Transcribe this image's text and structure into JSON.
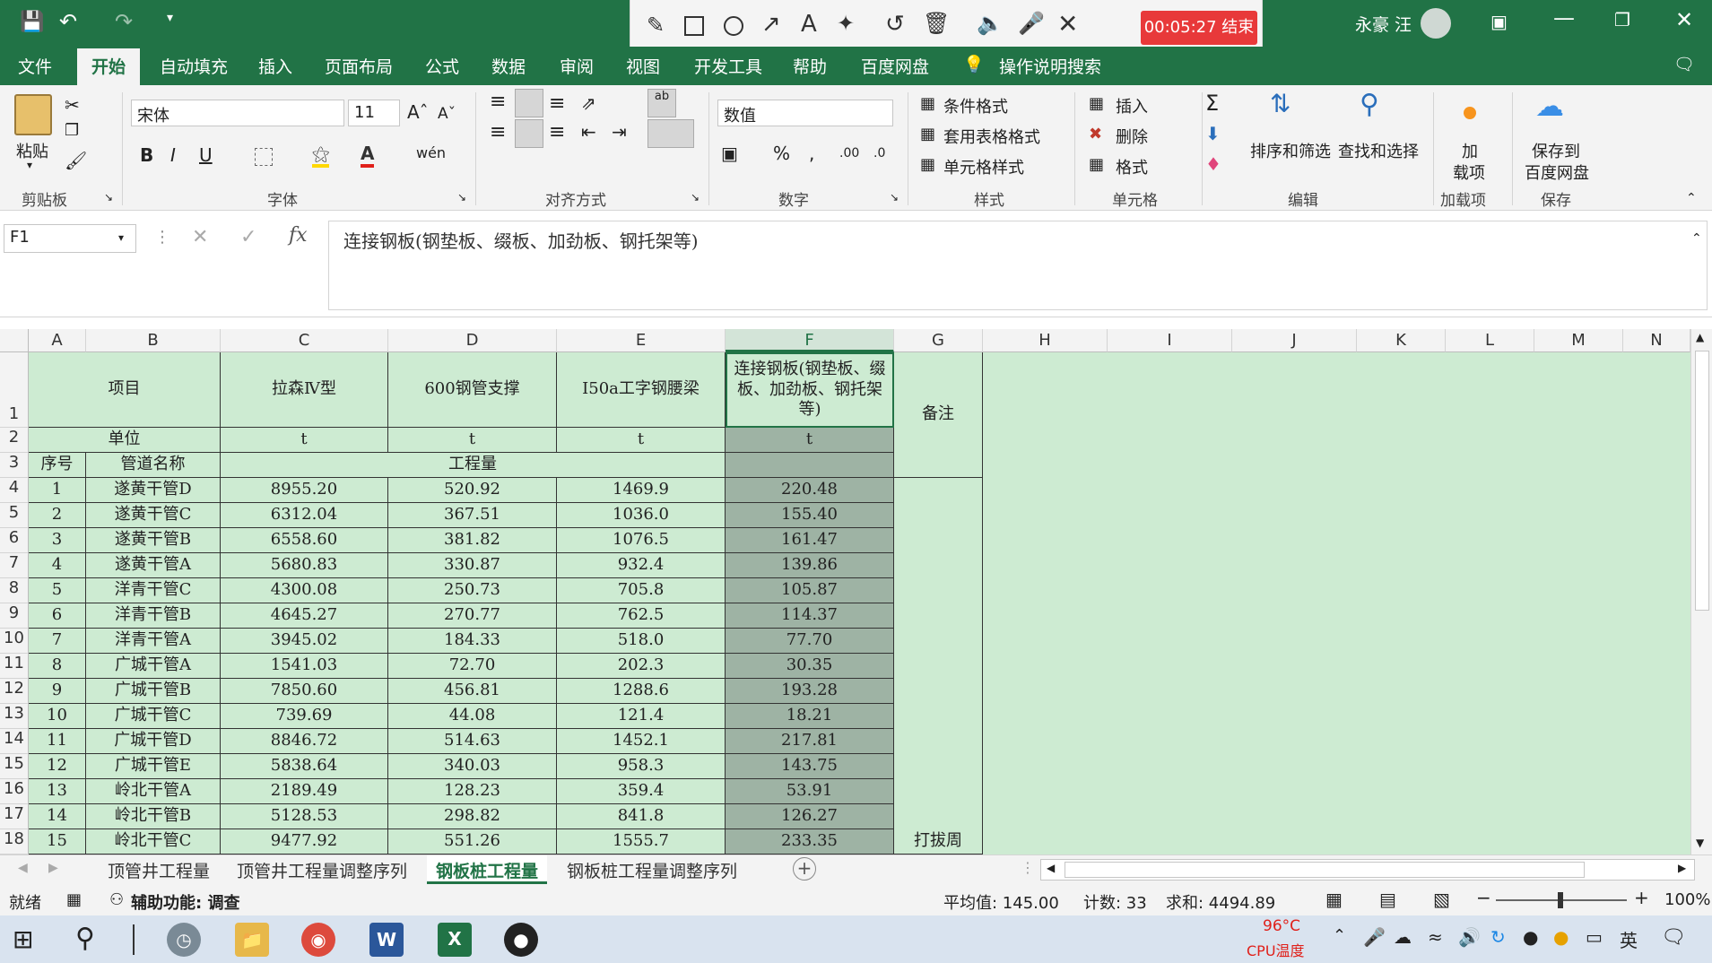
{
  "titlebar": {
    "user": "永豪 汪",
    "timer": "00:05:27 结束"
  },
  "menu": [
    "文件",
    "开始",
    "自动填充",
    "插入",
    "页面布局",
    "公式",
    "数据",
    "审阅",
    "视图",
    "开发工具",
    "帮助",
    "百度网盘",
    "操作说明搜索"
  ],
  "ribbon": {
    "paste": "粘贴",
    "font_name": "宋体",
    "font_size": "11",
    "number_format": "数值",
    "cond_format": "条件格式",
    "table_format": "套用表格格式",
    "cell_style": "单元格样式",
    "insert": "插入",
    "delete": "删除",
    "format": "格式",
    "sort_filter": "排序和筛选",
    "find_select": "查找和选择",
    "addin_1": "加",
    "addin_2": "载项",
    "save_to_1": "保存到",
    "save_to_2": "百度网盘",
    "groups": {
      "clipboard": "剪贴板",
      "font": "字体",
      "align": "对齐方式",
      "number": "数字",
      "style": "样式",
      "cells": "单元格",
      "edit": "编辑",
      "addin": "加载项",
      "save": "保存"
    }
  },
  "formula": {
    "namebox": "F1",
    "content": "连接钢板(钢垫板、缀板、加劲板、钢托架等)"
  },
  "columns": [
    "A",
    "B",
    "C",
    "D",
    "E",
    "F",
    "G",
    "H",
    "I",
    "J",
    "K",
    "L",
    "M",
    "N"
  ],
  "rows_header": [
    "1",
    "2",
    "3",
    "4",
    "5",
    "6",
    "7",
    "8",
    "9",
    "10",
    "11",
    "12",
    "13",
    "14",
    "15",
    "16",
    "17",
    "18"
  ],
  "sheet": {
    "h_item": "项目",
    "h_c": "拉森Ⅳ型",
    "h_d": "600钢管支撑",
    "h_e": "Ⅰ50a工字钢腰梁",
    "h_f": "连接钢板(钢垫板、缀板、加劲板、钢托架等)",
    "h_g": "备注",
    "unit_label": "单位",
    "unit_c": "t",
    "unit_d": "t",
    "unit_e": "t",
    "unit_f": "t",
    "seq_label": "序号",
    "pipe_label": "管道名称",
    "qty_label": "工程量",
    "note_g18": "打拔周",
    "rows": [
      [
        "1",
        "遂黄干管D",
        "8955.20",
        "520.92",
        "1469.9",
        "220.48"
      ],
      [
        "2",
        "遂黄干管C",
        "6312.04",
        "367.51",
        "1036.0",
        "155.40"
      ],
      [
        "3",
        "遂黄干管B",
        "6558.60",
        "381.82",
        "1076.5",
        "161.47"
      ],
      [
        "4",
        "遂黄干管A",
        "5680.83",
        "330.87",
        "932.4",
        "139.86"
      ],
      [
        "5",
        "洋青干管C",
        "4300.08",
        "250.73",
        "705.8",
        "105.87"
      ],
      [
        "6",
        "洋青干管B",
        "4645.27",
        "270.77",
        "762.5",
        "114.37"
      ],
      [
        "7",
        "洋青干管A",
        "3945.02",
        "184.33",
        "518.0",
        "77.70"
      ],
      [
        "8",
        "广城干管A",
        "1541.03",
        "72.70",
        "202.3",
        "30.35"
      ],
      [
        "9",
        "广城干管B",
        "7850.60",
        "456.81",
        "1288.6",
        "193.28"
      ],
      [
        "10",
        "广城干管C",
        "739.69",
        "44.08",
        "121.4",
        "18.21"
      ],
      [
        "11",
        "广城干管D",
        "8846.72",
        "514.63",
        "1452.1",
        "217.81"
      ],
      [
        "12",
        "广城干管E",
        "5838.64",
        "340.03",
        "958.3",
        "143.75"
      ],
      [
        "13",
        "岭北干管A",
        "2189.49",
        "128.23",
        "359.4",
        "53.91"
      ],
      [
        "14",
        "岭北干管B",
        "5128.53",
        "298.82",
        "841.8",
        "126.27"
      ],
      [
        "15",
        "岭北干管C",
        "9477.92",
        "551.26",
        "1555.7",
        "233.35"
      ]
    ]
  },
  "tabs": [
    "顶管井工程量",
    "顶管井工程量调整序列",
    "钢板桩工程量",
    "钢板桩工程量调整序列"
  ],
  "status": {
    "ready": "就绪",
    "accessibility": "辅助功能: 调查",
    "average": "平均值: 145.00",
    "count": "计数: 33",
    "sum": "求和: 4494.89",
    "zoom": "100%"
  },
  "taskbar": {
    "temp": "96°C",
    "temp_label": "CPU温度",
    "ime": "英"
  },
  "colors": {
    "excel_green": "#217346",
    "cell_fill": "#cdebd2",
    "selected_fill": "#9eb3a4"
  }
}
